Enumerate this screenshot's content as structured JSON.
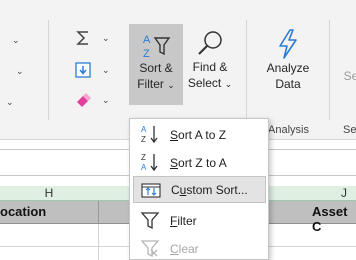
{
  "ribbon": {
    "sort_filter": {
      "line1": "Sort &",
      "line2": "Filter",
      "icon": "sort-filter-icon"
    },
    "find_select": {
      "line1": "Find &",
      "line2": "Select",
      "icon": "magnifier-icon"
    },
    "analyze_data": {
      "line1": "Analyze",
      "line2": "Data",
      "icon": "lightning-icon"
    },
    "sensitivity_partial": "Se",
    "groups": {
      "analysis": "Analysis",
      "partial": "Se"
    },
    "editing_icons": [
      "autosum-icon",
      "fill-down-icon",
      "eraser-icon"
    ]
  },
  "sheet": {
    "columns": {
      "h": "H",
      "j": "J"
    },
    "headers": {
      "location": "ocation",
      "asset": "Asset C"
    }
  },
  "sort_menu": {
    "items": [
      {
        "label": "Sort A to Z",
        "icon": "sort-a-to-z-icon",
        "enabled": true,
        "hover": false
      },
      {
        "label": "Sort Z to A",
        "icon": "sort-z-to-a-icon",
        "enabled": true,
        "hover": false
      },
      {
        "label": "Custom Sort...",
        "icon": "custom-sort-icon",
        "enabled": true,
        "hover": true
      },
      {
        "label": "Filter",
        "icon": "filter-icon",
        "enabled": true,
        "hover": false
      },
      {
        "label": "Clear",
        "icon": "clear-filter-icon",
        "enabled": false,
        "hover": false
      }
    ]
  },
  "colors": {
    "accent_blue": "#2b7cd3",
    "eraser_pink": "#e0409a",
    "hover_bg": "#e3e3e3",
    "col_header_green": "#dff0e3"
  }
}
